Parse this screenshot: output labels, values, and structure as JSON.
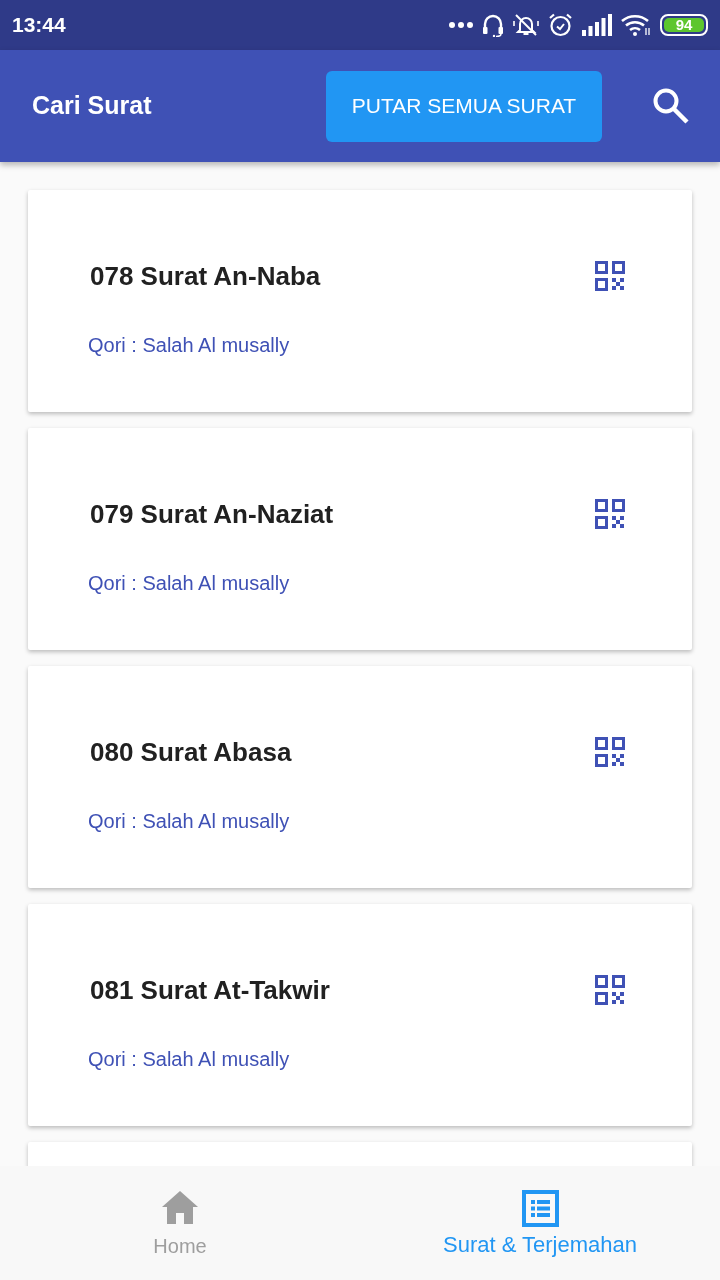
{
  "status_bar": {
    "time": "13:44",
    "battery": "94"
  },
  "app_bar": {
    "title": "Cari Surat",
    "play_all_button": "PUTAR SEMUA SURAT"
  },
  "list": {
    "cards": [
      {
        "title": "078 Surat An-Naba",
        "reciter": "Qori : Salah Al musally"
      },
      {
        "title": "079 Surat An-Naziat",
        "reciter": "Qori : Salah Al musally"
      },
      {
        "title": "080 Surat Abasa",
        "reciter": "Qori : Salah Al musally"
      },
      {
        "title": "081 Surat At-Takwir",
        "reciter": "Qori : Salah Al musally"
      }
    ],
    "more_below": true
  },
  "bottom_nav": [
    {
      "kind": "home",
      "label": "Home",
      "selected": false
    },
    {
      "kind": "list",
      "label": "Surat & Terjemahan",
      "selected": true
    }
  ]
}
